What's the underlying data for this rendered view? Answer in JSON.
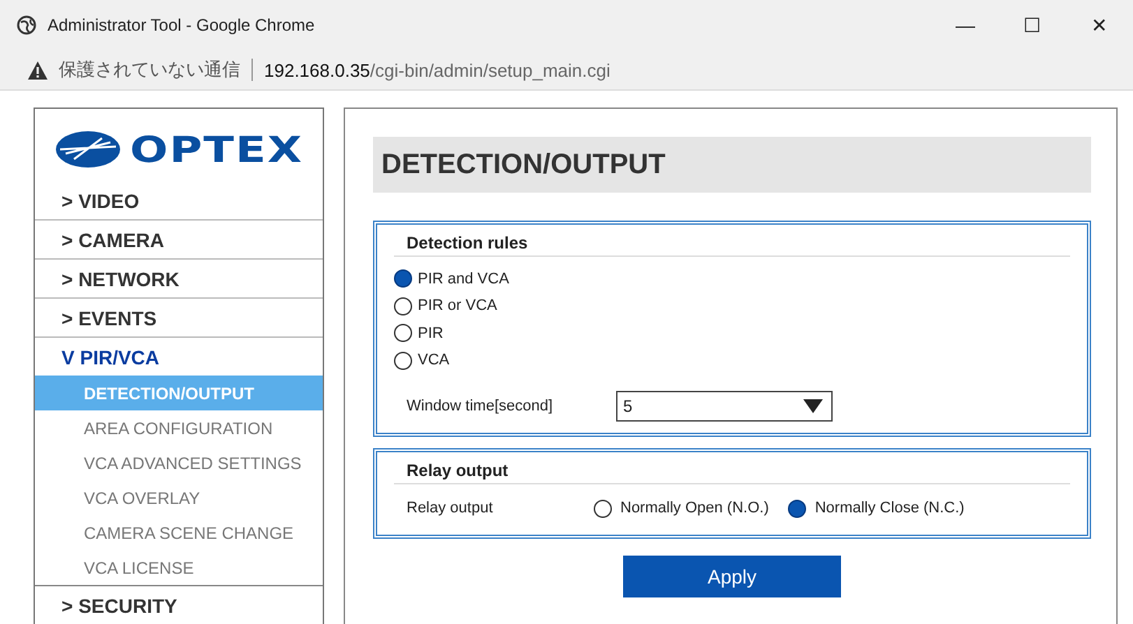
{
  "window": {
    "title": "Administrator Tool - Google Chrome",
    "controls": [
      "—",
      "☐",
      "✕"
    ]
  },
  "address_bar": {
    "warning": "保護されていない通信",
    "host": "192.168.0.35",
    "path": "/cgi-bin/admin/setup_main.cgi"
  },
  "sidebar": {
    "logo": "OPTEX",
    "items": [
      {
        "label": "> VIDEO",
        "expanded": false
      },
      {
        "label": "> CAMERA",
        "expanded": false
      },
      {
        "label": "> NETWORK",
        "expanded": false
      },
      {
        "label": "> EVENTS",
        "expanded": false
      },
      {
        "label": "V PIR/VCA",
        "expanded": true,
        "children": [
          {
            "label": "DETECTION/OUTPUT",
            "selected": true
          },
          {
            "label": "AREA CONFIGURATION",
            "selected": false
          },
          {
            "label": "VCA ADVANCED SETTINGS",
            "selected": false
          },
          {
            "label": "VCA OVERLAY",
            "selected": false
          },
          {
            "label": "CAMERA SCENE CHANGE",
            "selected": false
          },
          {
            "label": "VCA LICENSE",
            "selected": false
          }
        ]
      },
      {
        "label": "> SECURITY",
        "expanded": false
      }
    ]
  },
  "page": {
    "title": "DETECTION/OUTPUT",
    "detection_rules": {
      "title": "Detection rules",
      "options": [
        {
          "label": "PIR and VCA",
          "selected": true
        },
        {
          "label": "PIR or VCA",
          "selected": false
        },
        {
          "label": "PIR",
          "selected": false
        },
        {
          "label": "VCA",
          "selected": false
        }
      ],
      "window_time": {
        "label": "Window time[second]",
        "value": "5"
      }
    },
    "relay_output": {
      "title": "Relay output",
      "label": "Relay output",
      "options": [
        {
          "label": "Normally Open (N.O.)",
          "selected": false
        },
        {
          "label": "Normally Close (N.C.)",
          "selected": true
        }
      ]
    },
    "apply_button": "Apply"
  }
}
